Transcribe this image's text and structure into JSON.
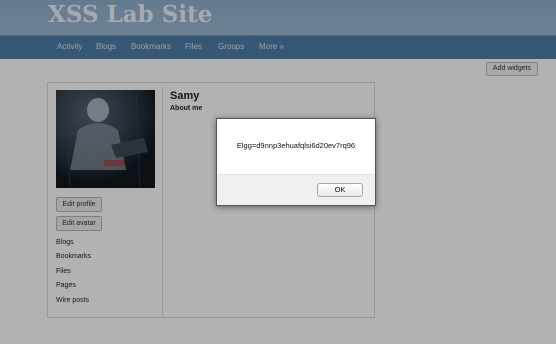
{
  "header": {
    "site_title": "XSS Lab Site"
  },
  "nav": {
    "activity": "Activity",
    "blogs": "Blogs",
    "bookmarks": "Bookmarks",
    "files": "Files",
    "groups": "Groups",
    "more": "More »"
  },
  "main": {
    "add_widgets_label": "Add widgets"
  },
  "profile": {
    "name": "Samy",
    "about_label": "About me",
    "edit_profile_label": "Edit profile",
    "edit_avatar_label": "Edit avatar",
    "menu": {
      "blogs": "Blogs",
      "bookmarks": "Bookmarks",
      "files": "Files",
      "pages": "Pages",
      "wire_posts": "Wire posts"
    }
  },
  "alert": {
    "message": "Elgg=d9nnp3ehuafqlsi6d20ev7rq96",
    "ok_label": "OK"
  },
  "colors": {
    "header": "#9dbad4",
    "nav": "#4f7ea8",
    "overlay": "rgba(0,0,0,0.30)"
  }
}
